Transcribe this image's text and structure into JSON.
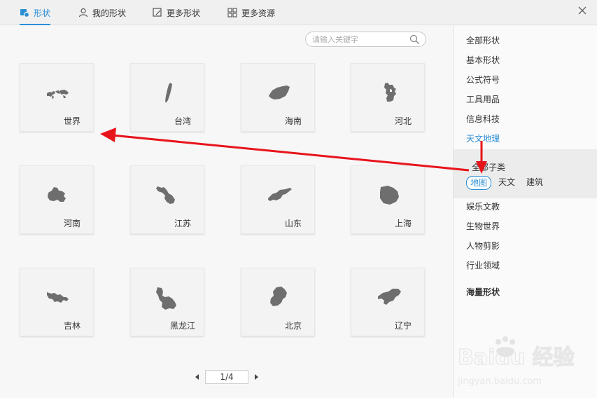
{
  "tabs": [
    {
      "label": "形状",
      "icon": "shapes-icon",
      "active": true
    },
    {
      "label": "我的形状",
      "icon": "user-icon",
      "active": false
    },
    {
      "label": "更多形状",
      "icon": "edit-shape-icon",
      "active": false
    },
    {
      "label": "更多资源",
      "icon": "grid-icon",
      "active": false
    }
  ],
  "search": {
    "placeholder": "请输入关键字"
  },
  "cards": [
    {
      "label": "世界",
      "icon": "world-map-icon"
    },
    {
      "label": "台湾",
      "icon": "taiwan-map-icon"
    },
    {
      "label": "海南",
      "icon": "hainan-map-icon"
    },
    {
      "label": "河北",
      "icon": "hebei-map-icon"
    },
    {
      "label": "河南",
      "icon": "henan-map-icon"
    },
    {
      "label": "江苏",
      "icon": "jiangsu-map-icon"
    },
    {
      "label": "山东",
      "icon": "shandong-map-icon"
    },
    {
      "label": "上海",
      "icon": "shanghai-map-icon"
    },
    {
      "label": "吉林",
      "icon": "jilin-map-icon"
    },
    {
      "label": "黑龙江",
      "icon": "heilongjiang-map-icon"
    },
    {
      "label": "北京",
      "icon": "beijing-map-icon"
    },
    {
      "label": "辽宁",
      "icon": "liaoning-map-icon"
    }
  ],
  "pager": {
    "text": "1/4"
  },
  "sidebar": {
    "top_items": [
      "全部形状",
      "基本形状",
      "公式符号",
      "工具用品",
      "信息科技",
      "天文地理"
    ],
    "active_item": "天文地理",
    "sub": {
      "title": "全部子类",
      "chips": [
        "地图",
        "天文",
        "建筑"
      ],
      "active_chip": "地图"
    },
    "bottom_items": [
      "娱乐文教",
      "生物世界",
      "人物剪影",
      "行业领域"
    ],
    "bold_item": "海量形状"
  },
  "watermark": {
    "text": "Baidu 经验",
    "sub": "jingyan.baidu.com"
  },
  "colors": {
    "accent": "#2a8fd6",
    "arrow": "#e8141c",
    "shape": "#6e6e6e"
  }
}
